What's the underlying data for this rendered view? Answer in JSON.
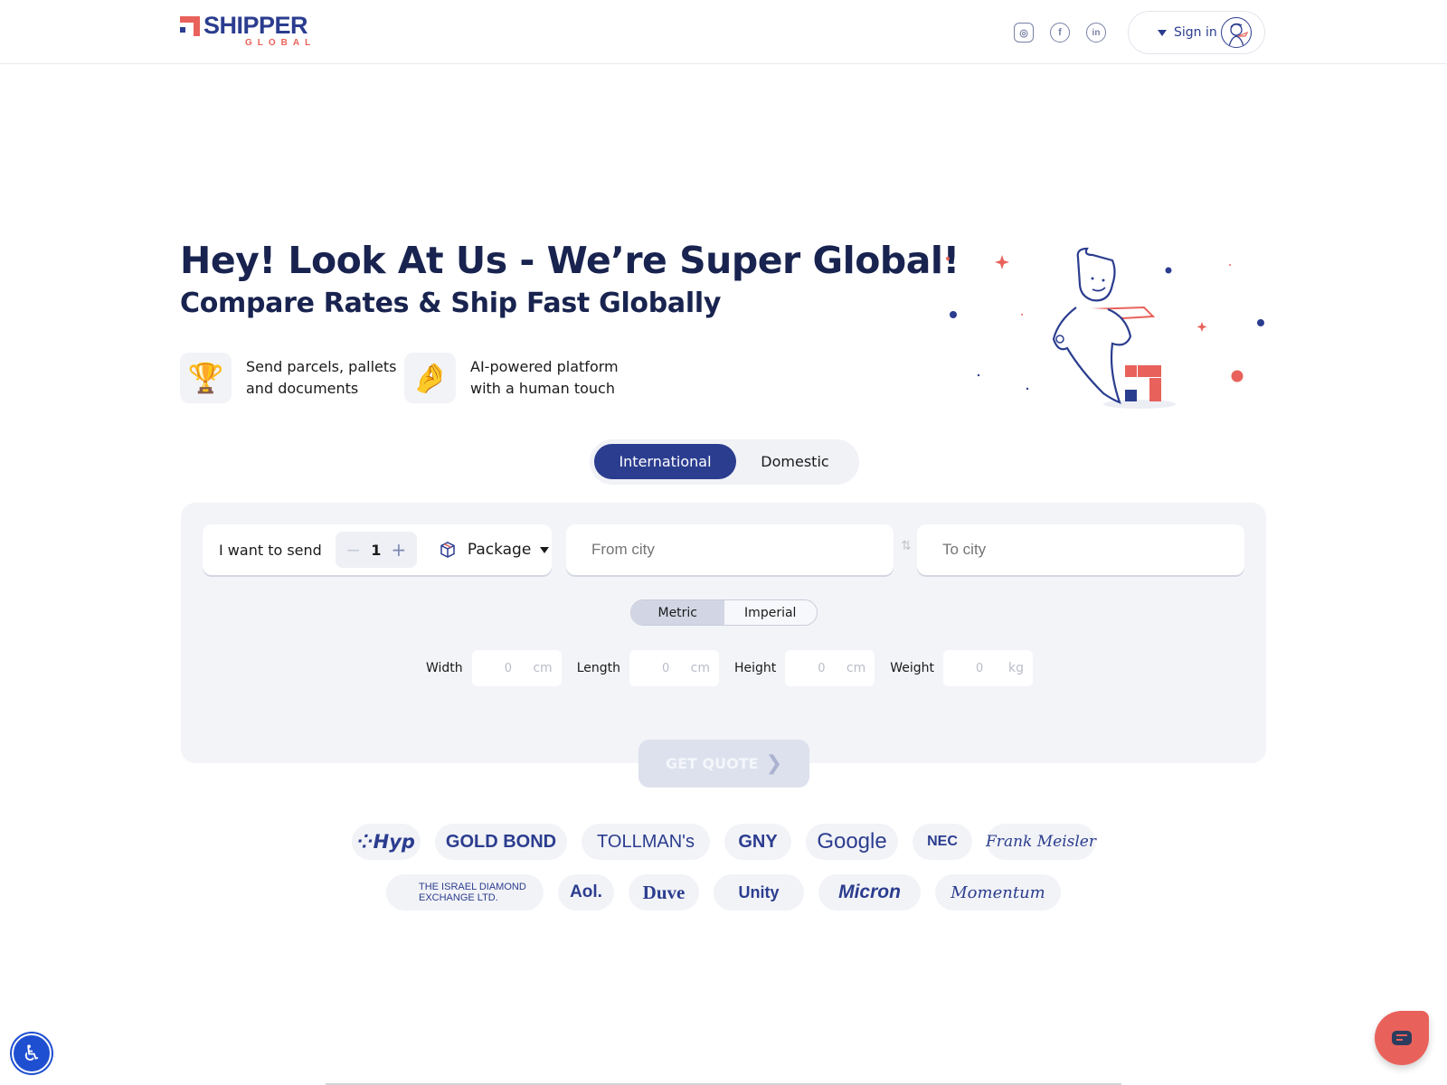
{
  "header": {
    "logo": {
      "main": "SHIPPER",
      "sub": "GLOBAL"
    },
    "social": [
      {
        "name": "instagram",
        "glyph": "◎"
      },
      {
        "name": "facebook",
        "glyph": "f"
      },
      {
        "name": "linkedin",
        "glyph": "in"
      }
    ],
    "signin_label": "Sign in"
  },
  "hero": {
    "title": "Hey! Look At Us - We’re Super Global!",
    "subtitle": "Compare Rates & Ship Fast Globally",
    "features": [
      {
        "icon": "🏆",
        "line1": "Send parcels, pallets",
        "line2": "and documents"
      },
      {
        "icon": "🤌",
        "line1": "AI-powered platform",
        "line2": "with a human touch"
      }
    ]
  },
  "tabs": {
    "international": "International",
    "domestic": "Domestic",
    "active": "International"
  },
  "form": {
    "send_label": "I want to send",
    "quantity": "1",
    "minus": "−",
    "plus": "+",
    "package_type": "Package",
    "from_placeholder": "From city",
    "to_placeholder": "To city",
    "swap_glyph": "⇅",
    "units": {
      "metric": "Metric",
      "imperial": "Imperial",
      "selected": "Metric"
    },
    "dims": [
      {
        "label": "Width",
        "value": "0",
        "unit": "cm"
      },
      {
        "label": "Length",
        "value": "0",
        "unit": "cm"
      },
      {
        "label": "Height",
        "value": "0",
        "unit": "cm"
      },
      {
        "label": "Weight",
        "value": "0",
        "unit": "kg"
      }
    ],
    "quote_label": "GET QUOTE",
    "quote_arrow": "❯"
  },
  "clients": {
    "row1": [
      "⁘Hyp",
      "GOLD BOND",
      "TOLLMAN's",
      "GNY",
      "Google",
      "NEC",
      "Frank Meisler"
    ],
    "row2": [
      "THE ISRAEL DIAMOND EXCHANGE LTD.",
      "Aol.",
      "Duve",
      "Unity",
      "Micron",
      "Momentum"
    ]
  },
  "widgets": {
    "accessibility_glyph": "♿"
  },
  "colors": {
    "brand_navy": "#2b3d8f",
    "brand_red": "#e8625b",
    "heading": "#18234f"
  }
}
